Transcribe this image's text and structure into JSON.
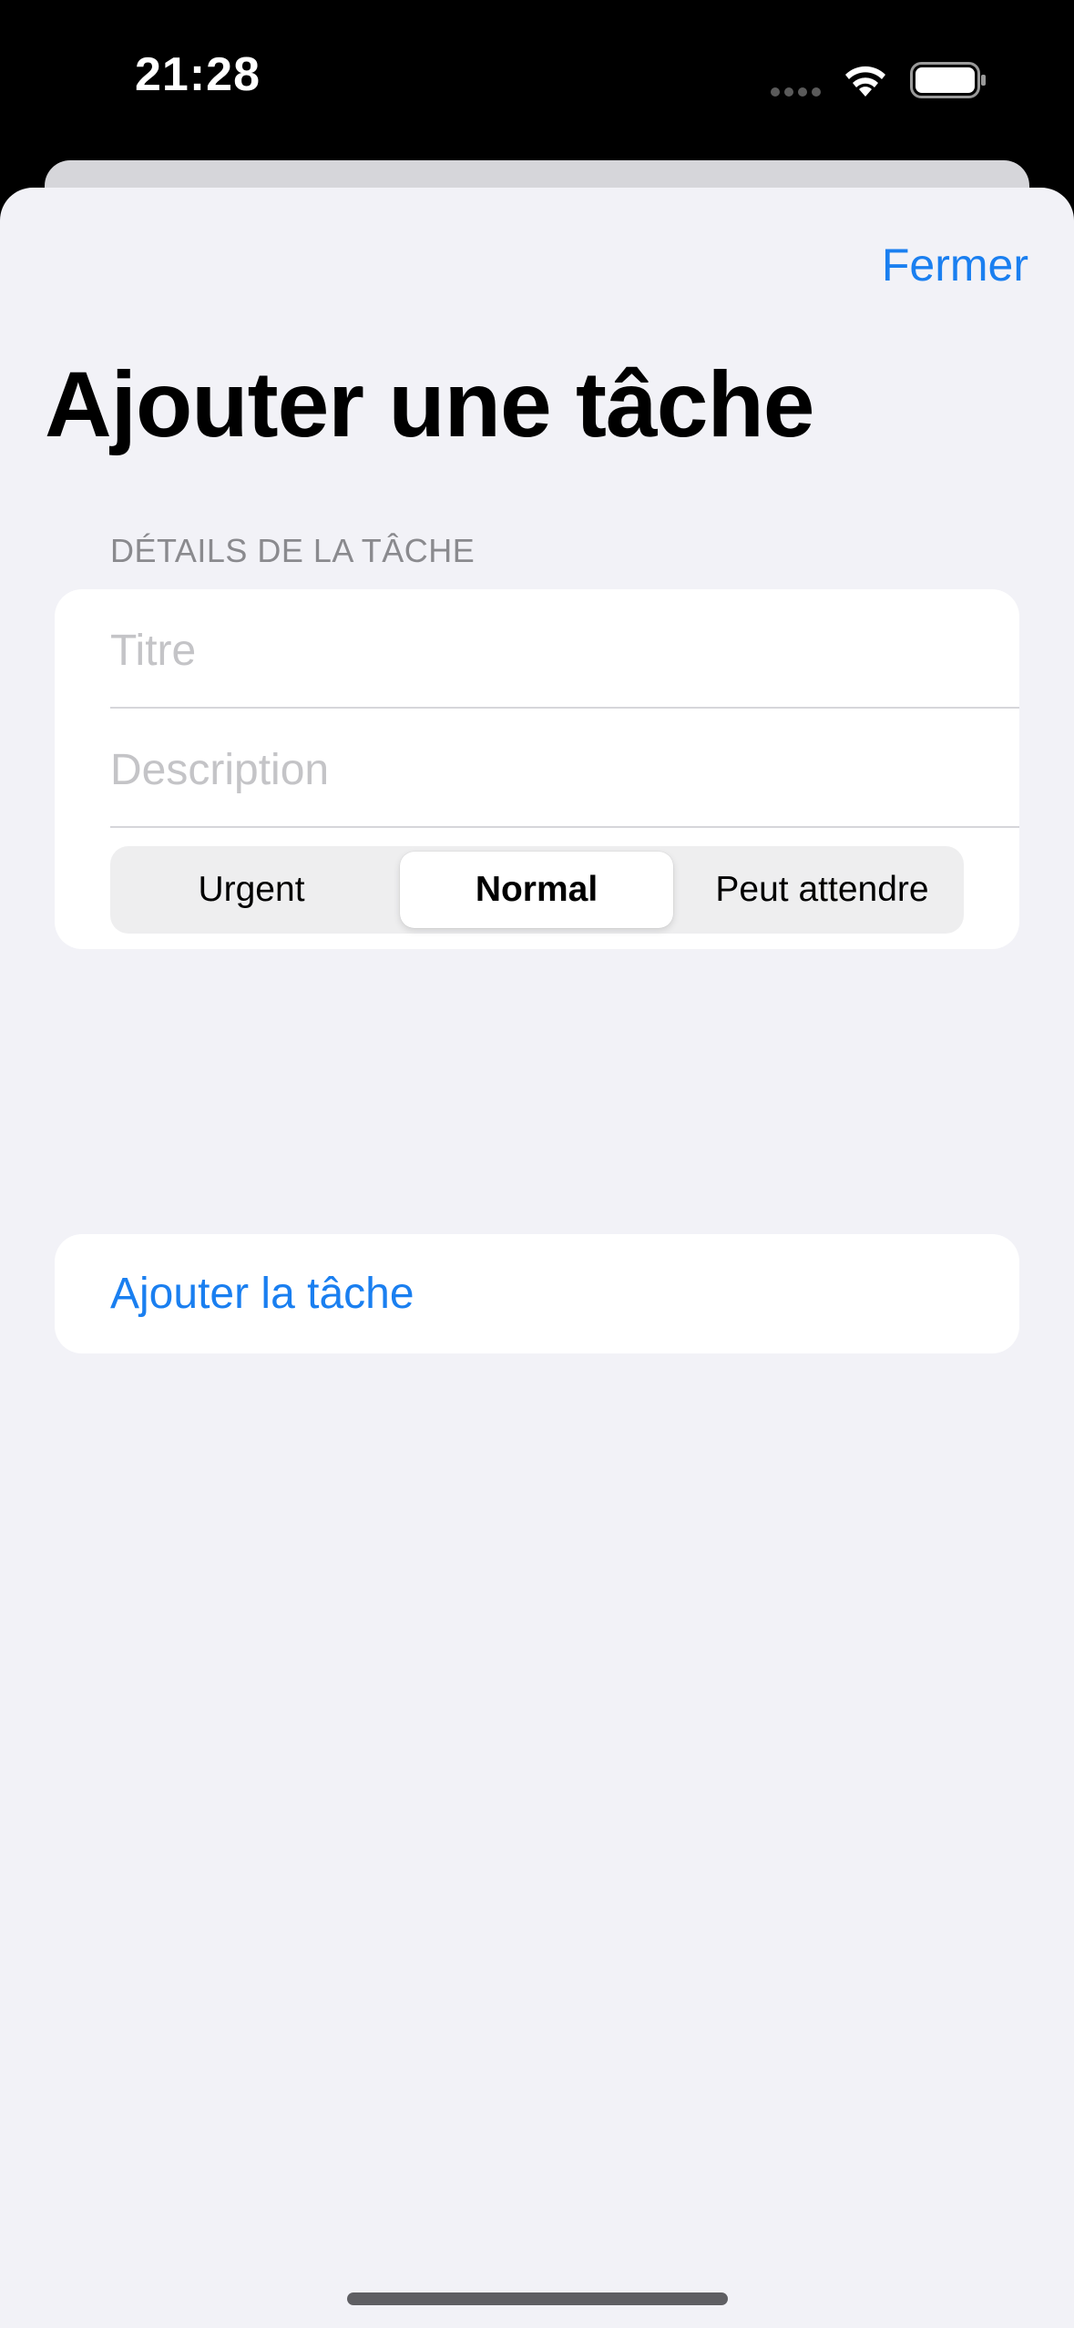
{
  "status_bar": {
    "time": "21:28",
    "icons": [
      "signal-dots-icon",
      "wifi-icon",
      "battery-icon"
    ]
  },
  "header": {
    "close_label": "Fermer",
    "title": "Ajouter une tâche"
  },
  "form": {
    "section_header": "DÉTAILS DE LA TÂCHE",
    "title_field": {
      "placeholder": "Titre",
      "value": ""
    },
    "description_field": {
      "placeholder": "Description",
      "value": ""
    },
    "priority": {
      "options": [
        "Urgent",
        "Normal",
        "Peut attendre"
      ],
      "selected": "Normal"
    }
  },
  "actions": {
    "add_task_label": "Ajouter la tâche"
  },
  "colors": {
    "accent": "#1a7ff0",
    "background": "#f2f2f7",
    "card": "#ffffff",
    "section_header": "#8a8a8e",
    "placeholder": "#c4c4c7"
  }
}
